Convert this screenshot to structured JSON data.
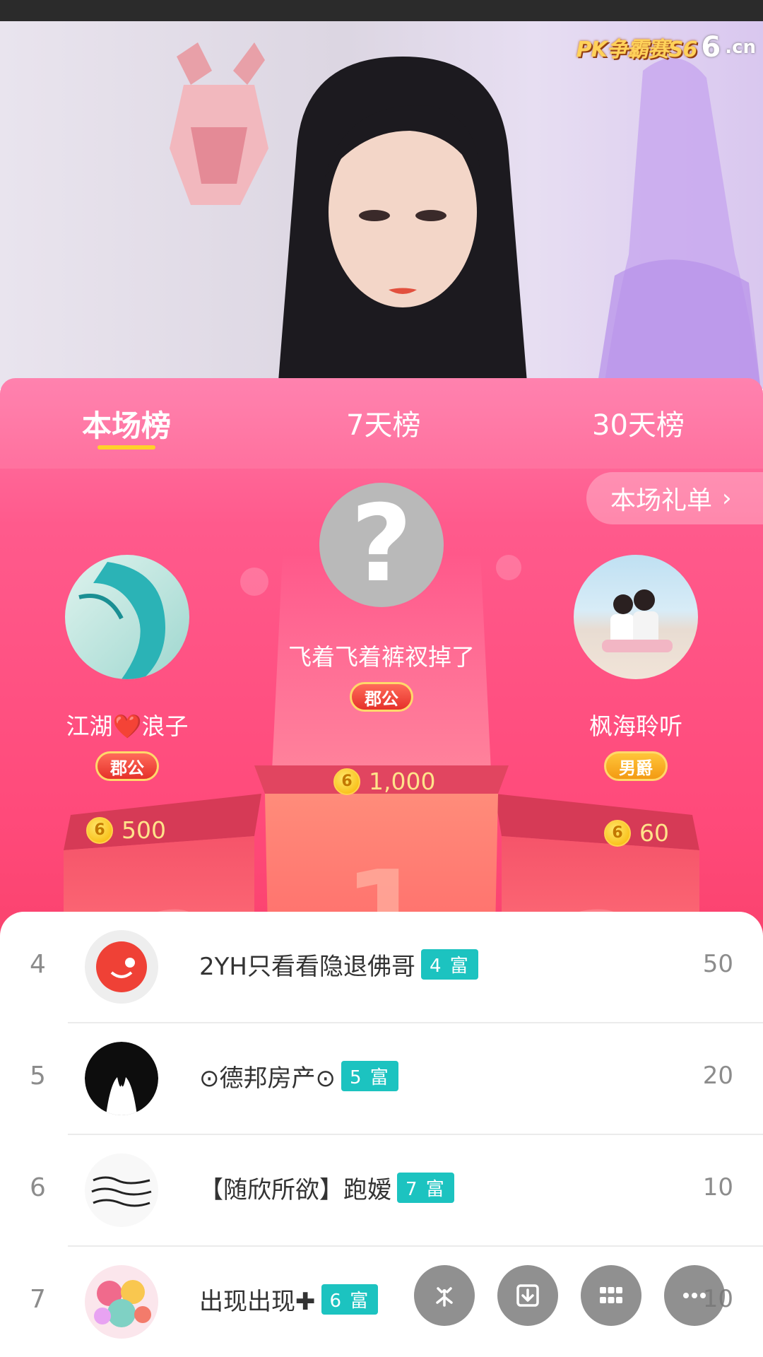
{
  "header": {
    "logo_pk": "PK争霸赛S6",
    "logo_brand": "6",
    "logo_domain": ".cn"
  },
  "tabs": [
    {
      "label": "本场榜",
      "active": true
    },
    {
      "label": "7天榜",
      "active": false
    },
    {
      "label": "30天榜",
      "active": false
    }
  ],
  "gift_list": {
    "label": "本场礼单",
    "icon": "chevron-right-icon"
  },
  "podium": {
    "first": {
      "name": "飞着飞着裤衩掉了",
      "badge": "郡公",
      "coin": "6",
      "score": "1,000",
      "avatar": "question-mark-avatar"
    },
    "second": {
      "name": "江湖❤️浪子",
      "badge": "郡公",
      "coin": "6",
      "score": "500",
      "avatar": "dragon-avatar"
    },
    "third": {
      "name": "枫海聆听",
      "badge": "男爵",
      "coin": "6",
      "score": "60",
      "avatar": "couple-avatar"
    }
  },
  "list": [
    {
      "rank": "4",
      "name": "2YH只看看隐退佛哥",
      "level": "4 富",
      "value": "50"
    },
    {
      "rank": "5",
      "name": "⊙德邦房产⊙",
      "level": "5 富",
      "value": "20"
    },
    {
      "rank": "6",
      "name": "【随欣所欲】跑嫒",
      "level": "7 富",
      "value": "10"
    },
    {
      "rank": "7",
      "name": "出现出现✚",
      "level": "6 富",
      "value": "10"
    }
  ],
  "fab_icons": [
    "sparkle-icon",
    "download-icon",
    "grid-icon",
    "more-icon"
  ],
  "colors": {
    "accent": "#ff4a7a",
    "level_badge": "#1cc3c0",
    "tab_underline": "#ffd12a"
  }
}
